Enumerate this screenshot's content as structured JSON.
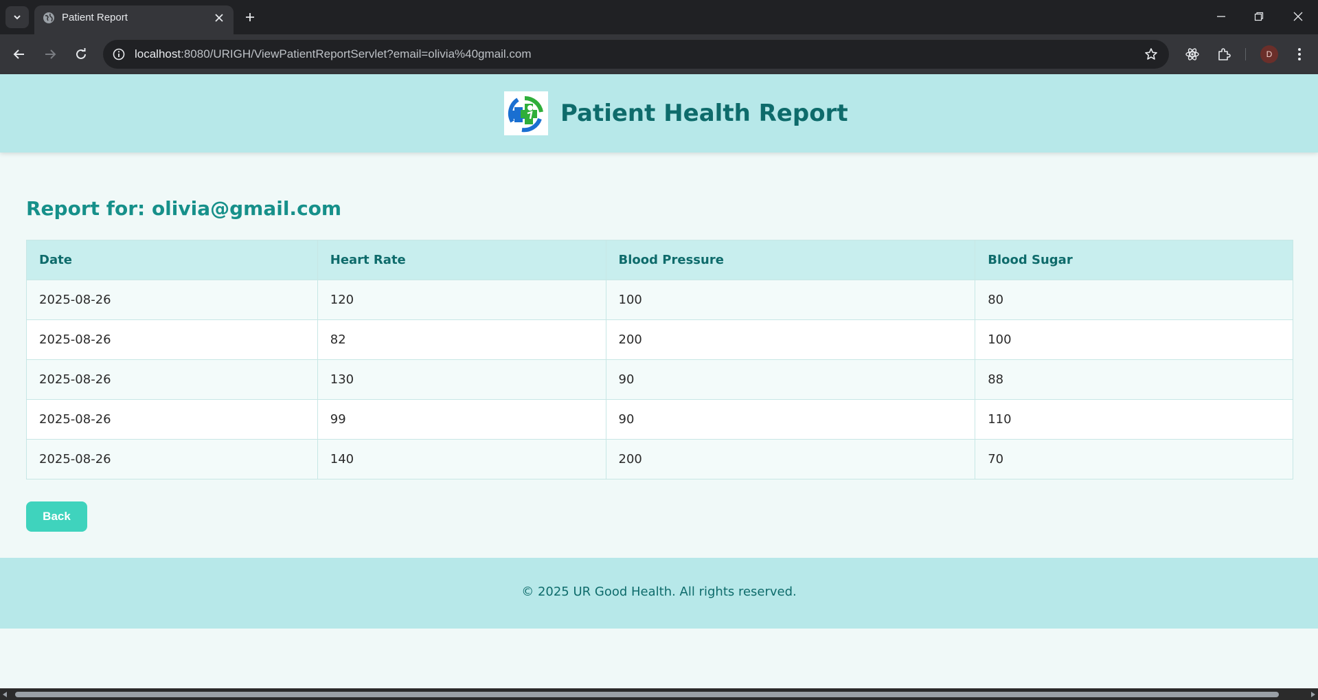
{
  "browser": {
    "tab_title": "Patient Report",
    "url_host": "localhost",
    "url_rest": ":8080/URIGH/ViewPatientReportServlet?email=olivia%40gmail.com",
    "profile_initial": "D"
  },
  "header": {
    "title": "Patient Health Report"
  },
  "report": {
    "heading": "Report for: olivia@gmail.com",
    "columns": [
      "Date",
      "Heart Rate",
      "Blood Pressure",
      "Blood Sugar"
    ],
    "rows": [
      [
        "2025-08-26",
        "120",
        "100",
        "80"
      ],
      [
        "2025-08-26",
        "82",
        "200",
        "100"
      ],
      [
        "2025-08-26",
        "130",
        "90",
        "88"
      ],
      [
        "2025-08-26",
        "99",
        "90",
        "110"
      ],
      [
        "2025-08-26",
        "140",
        "200",
        "70"
      ]
    ]
  },
  "actions": {
    "back_label": "Back"
  },
  "footer": {
    "copyright": "© 2025 UR Good Health. All rights reserved."
  },
  "colors": {
    "header_bg": "#b7e8e9",
    "title_color": "#0e6b6b",
    "accent": "#16908a",
    "button": "#3fd3bd"
  }
}
